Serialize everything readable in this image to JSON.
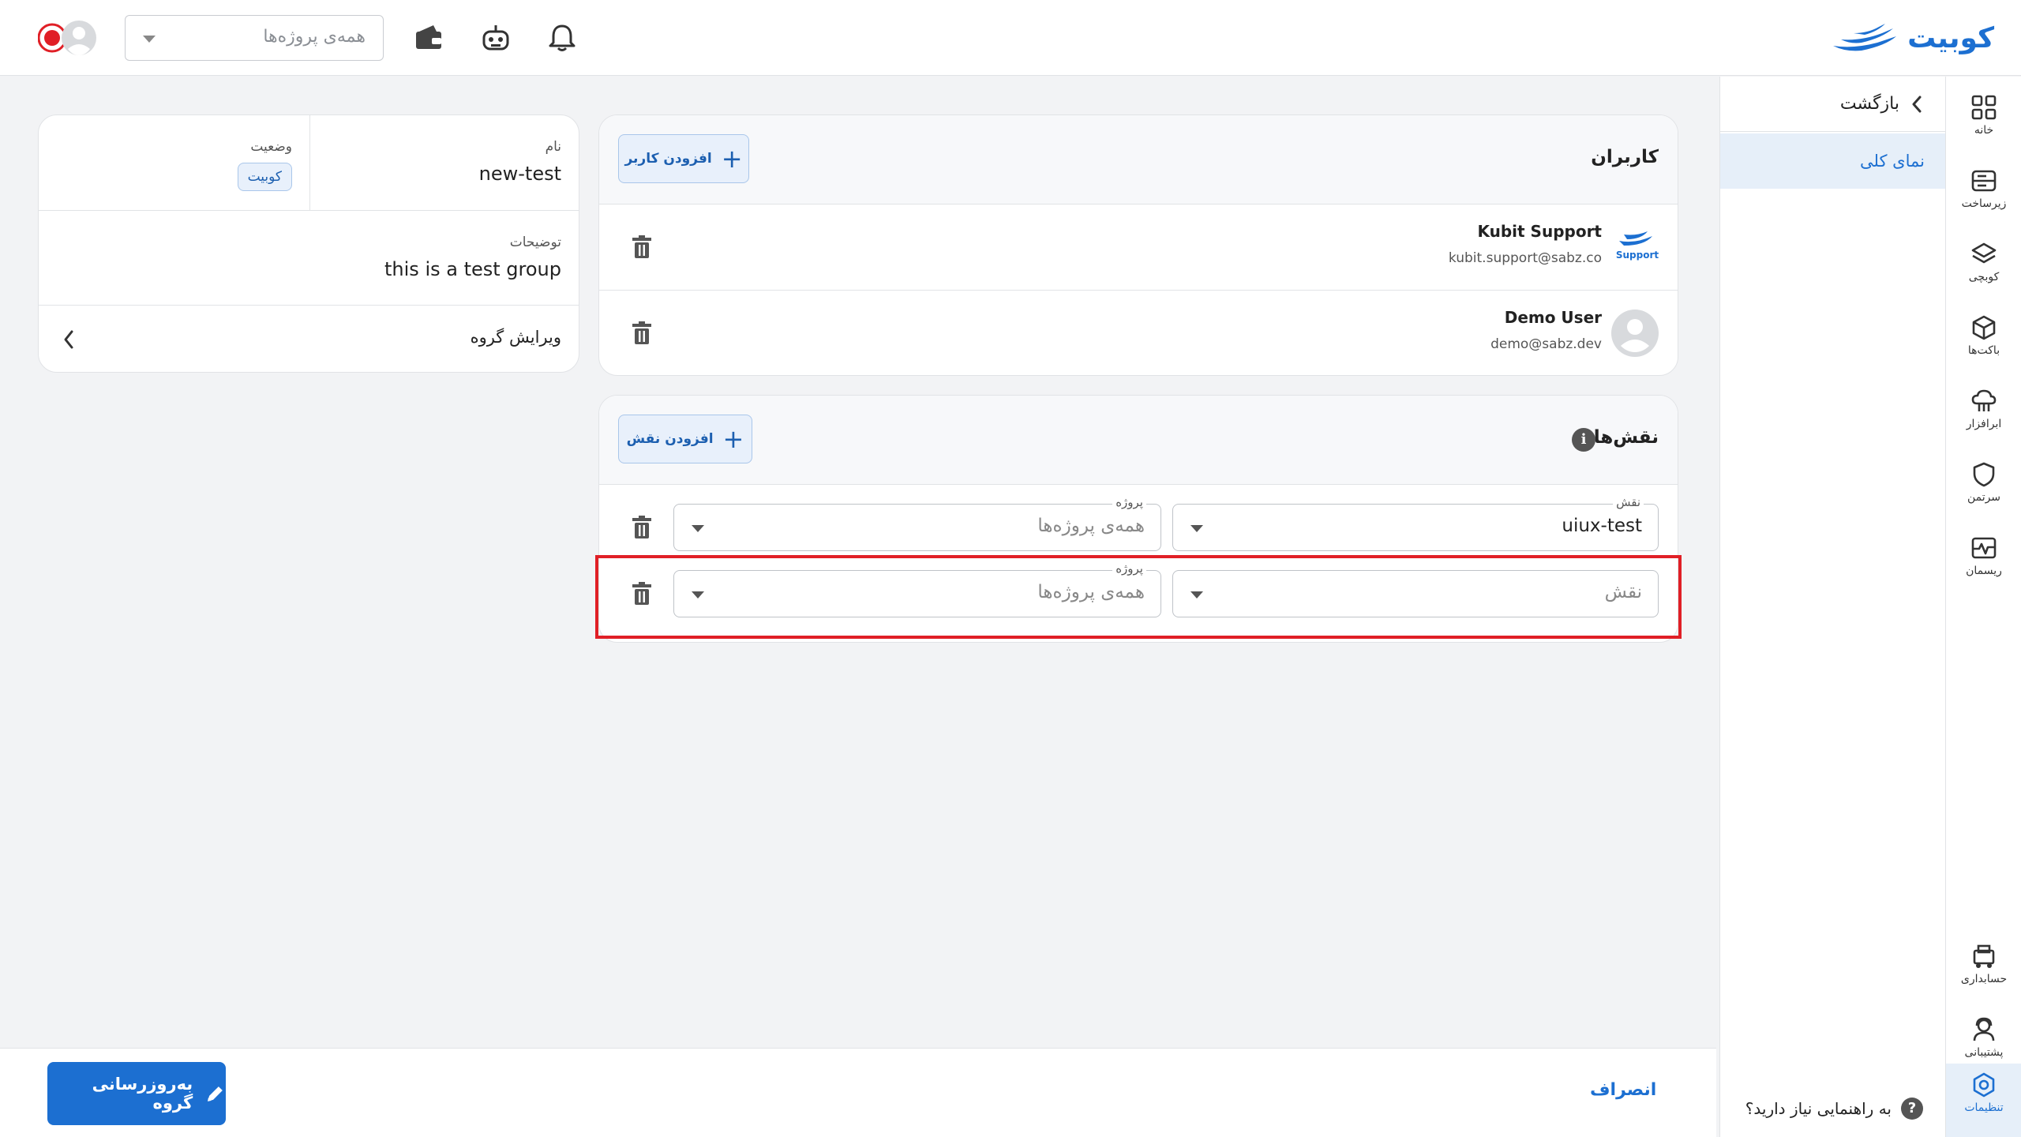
{
  "header": {
    "brand": "کوبیت",
    "project_select_placeholder": "همه‌ی پروژه‌ها",
    "icons": [
      "bell-icon",
      "robot-icon",
      "wallet-icon"
    ]
  },
  "sidebar": {
    "items": [
      {
        "label": "خانه",
        "icon": "grid-icon"
      },
      {
        "label": "زیرساخت",
        "icon": "server-icon"
      },
      {
        "label": "کوبچی",
        "icon": "layers-icon"
      },
      {
        "label": "باکت‌ها",
        "icon": "box-icon"
      },
      {
        "label": "ابرافزار",
        "icon": "cloud-app-icon"
      },
      {
        "label": "سرتمن",
        "icon": "shield-icon"
      },
      {
        "label": "ریسمان",
        "icon": "pulse-icon"
      },
      {
        "label": "حسابداری",
        "icon": "billing-icon"
      },
      {
        "label": "پشتیبانی",
        "icon": "support-icon"
      },
      {
        "label": "تنظیمات",
        "icon": "settings-icon"
      }
    ],
    "active": "تنظیمات"
  },
  "subnav": {
    "back_label": "بازگشت",
    "overview_label": "نمای کلی",
    "help_label": "به راهنمایی نیاز دارید؟"
  },
  "users_card": {
    "title": "کاربران",
    "add_button": "افزودن کاربر",
    "users": [
      {
        "name": "Kubit Support",
        "email": "kubit.support@sabz.co",
        "avatar_text": "Support"
      },
      {
        "name": "Demo User",
        "email": "demo@sabz.dev"
      }
    ]
  },
  "roles_card": {
    "title": "نقش‌ها",
    "add_button": "افزودن نقش",
    "rows": [
      {
        "role_label": "نقش",
        "role_value": "uiux-test",
        "project_label": "پروژه",
        "project_value": "همه‌ی پروژه‌ها"
      },
      {
        "role_label": "",
        "role_value": "نقش",
        "project_label": "پروژه",
        "project_value": "همه‌ی پروژه‌ها"
      }
    ]
  },
  "group_card": {
    "name_label": "نام",
    "name_value": "new-test",
    "status_label": "وضعیت",
    "status_value": "کوبیت",
    "description_label": "توضیحات",
    "description_value": "this is a test group",
    "edit_label": "ویرایش گروه"
  },
  "footer": {
    "update_button": "به‌روزرسانی گروه",
    "cancel_button": "انصراف"
  },
  "colors": {
    "accent": "#1c6fd1",
    "highlight": "#e01f26",
    "background": "#f2f3f5"
  }
}
